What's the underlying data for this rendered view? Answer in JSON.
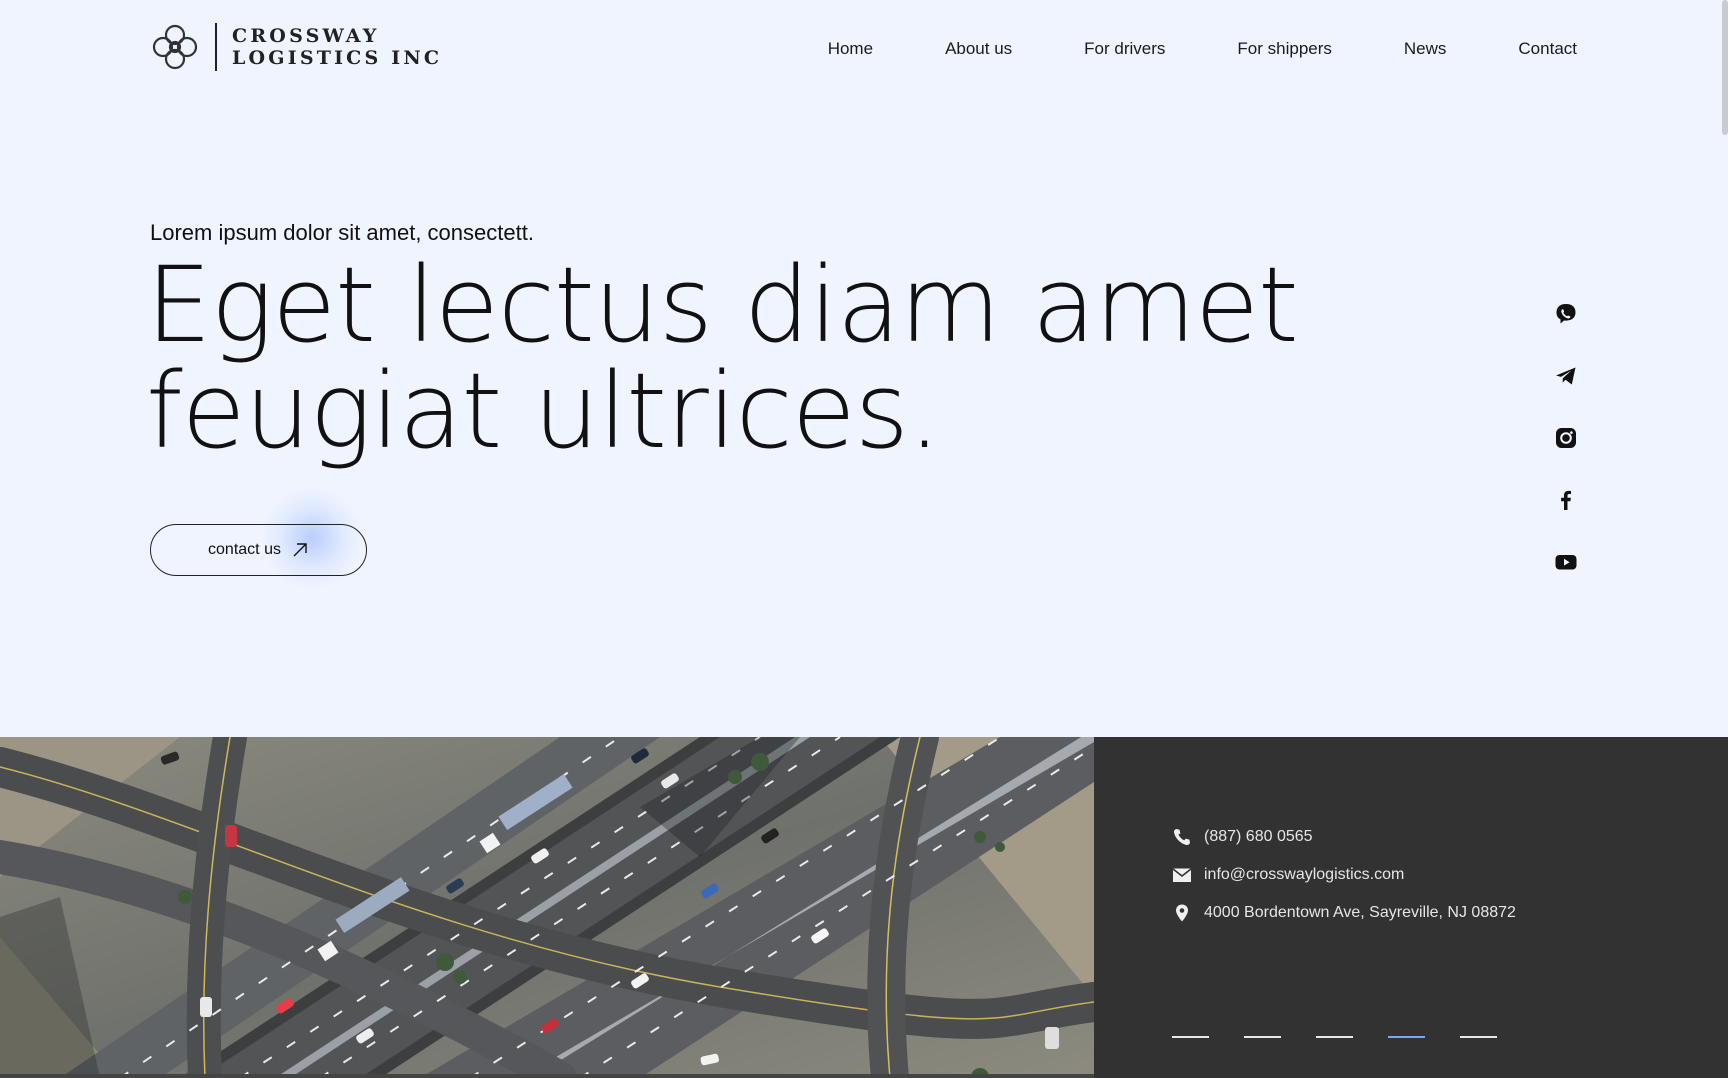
{
  "brand": {
    "line1": "CROSSWAY",
    "line2": "LOGISTICS INC"
  },
  "nav": {
    "items": [
      "Home",
      "About us",
      "For drivers",
      "For shippers",
      "News",
      "Contact"
    ]
  },
  "hero": {
    "eyebrow": "Lorem ipsum dolor sit amet, consectett.",
    "headline_line1": "Eget lectus diam amet",
    "headline_line2": "feugiat ultrices.",
    "cta_label": "contact us"
  },
  "social": [
    "viber-icon",
    "telegram-icon",
    "instagram-icon",
    "facebook-icon",
    "youtube-icon"
  ],
  "contact": {
    "phone": "(887) 680 0565",
    "email": "info@crosswaylogistics.com",
    "address": "4000 Bordentown Ave, Sayreville, NJ 08872"
  },
  "slider": {
    "count": 5,
    "active_index": 3
  },
  "colors": {
    "background": "#eff4fe",
    "panel": "#323232",
    "accent": "#78a6ff",
    "text": "#111111"
  }
}
